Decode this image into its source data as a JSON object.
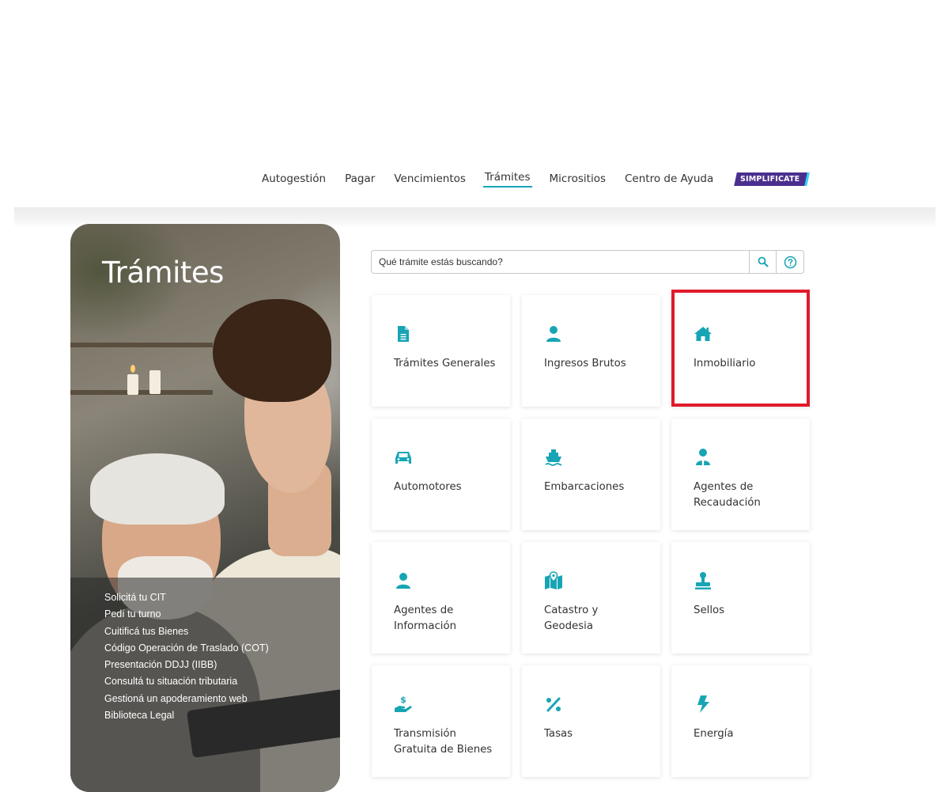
{
  "nav": {
    "items": [
      {
        "label": "Autogestión"
      },
      {
        "label": "Pagar"
      },
      {
        "label": "Vencimientos"
      },
      {
        "label": "Trámites"
      },
      {
        "label": "Micrositios"
      },
      {
        "label": "Centro de Ayuda"
      }
    ],
    "active": "Trámites",
    "badge": "SIMPLIFICATE"
  },
  "hero": {
    "title": "Trámites",
    "quick_links": [
      "Solicitá tu CIT",
      "Pedí tu turno",
      "Cuitificá tus Bienes",
      "Código Operación de Traslado (COT)",
      "Presentación DDJJ (IIBB)",
      "Consultá tu situación tributaria",
      "Gestioná un apoderamiento web",
      "Biblioteca Legal"
    ]
  },
  "search": {
    "placeholder": "Qué trámite estás buscando?",
    "value": ""
  },
  "cards": [
    {
      "label": "Trámites Generales",
      "icon": "document-icon"
    },
    {
      "label": "Ingresos Brutos",
      "icon": "person-icon"
    },
    {
      "label": "Inmobiliario",
      "icon": "house-icon"
    },
    {
      "label": "Automotores",
      "icon": "car-icon"
    },
    {
      "label": "Embarcaciones",
      "icon": "ship-icon"
    },
    {
      "label": "Agentes de Recaudación",
      "icon": "agent-icon"
    },
    {
      "label": "Agentes de Información",
      "icon": "person-icon"
    },
    {
      "label": "Catastro y Geodesia",
      "icon": "map-icon"
    },
    {
      "label": "Sellos",
      "icon": "stamp-icon"
    },
    {
      "label": "Transmisión Gratuita de Bienes",
      "icon": "hand-money-icon"
    },
    {
      "label": "Tasas",
      "icon": "percent-icon"
    },
    {
      "label": "Energía",
      "icon": "bolt-icon"
    }
  ],
  "highlighted_card": "Inmobiliario",
  "colors": {
    "accent": "#17a5b5",
    "highlight": "#e01a2b",
    "badge": "#4b2f8f"
  }
}
